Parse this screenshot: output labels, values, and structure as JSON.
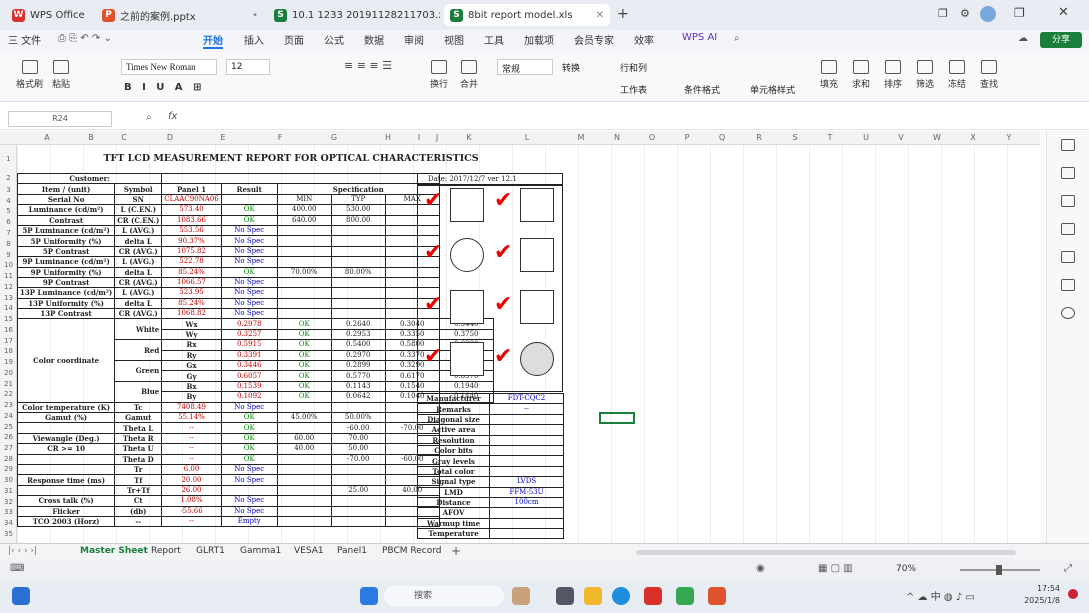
{
  "tabs": [
    {
      "label": "WPS Office",
      "color": "#d9302c",
      "letter": "W"
    },
    {
      "label": "之前的案例.pptx",
      "color": "#e0522b",
      "letter": "P"
    },
    {
      "label": "10.1 1233 20191128211703.xls",
      "color": "#1a7f3c",
      "letter": "S"
    },
    {
      "label": "8bit report model.xls",
      "color": "#1a7f3c",
      "letter": "S"
    }
  ],
  "menu": {
    "file": "三 文件",
    "items": [
      "开始",
      "插入",
      "页面",
      "公式",
      "数据",
      "审阅",
      "视图",
      "工具",
      "加载项",
      "会员专家",
      "效率"
    ],
    "ai": "WPS AI",
    "share": "分享"
  },
  "ribbon": {
    "font": "Times New Roman",
    "size": "12",
    "cellstyle": "常规",
    "labels": [
      "格式刷",
      "粘贴",
      "",
      "",
      "换行",
      "合并",
      "",
      "",
      "",
      "",
      "",
      "转换",
      "行和列",
      "工作表",
      "条件格式",
      "单元格样式",
      "填充",
      "求和",
      "排序",
      "筛选",
      "冻结",
      "查找"
    ]
  },
  "formula": {
    "cellref": "R24",
    "fx": "fx"
  },
  "columns": [
    "A",
    "B",
    "C",
    "D",
    "E",
    "F",
    "G",
    "H",
    "I",
    "J",
    "K",
    "L",
    "M",
    "N",
    "O",
    "P",
    "Q",
    "R",
    "S",
    "T",
    "U",
    "V",
    "W",
    "X",
    "Y"
  ],
  "rows": [
    "1",
    "2",
    "3",
    "4",
    "5",
    "6",
    "7",
    "8",
    "9",
    "10",
    "11",
    "12",
    "13",
    "14",
    "15",
    "16",
    "17",
    "18",
    "19",
    "20",
    "21",
    "22",
    "23",
    "24",
    "25",
    "26",
    "27",
    "28",
    "29",
    "30",
    "31",
    "32",
    "33",
    "34",
    "35"
  ],
  "report": {
    "title": "TFT LCD MEASUREMENT REPORT FOR OPTICAL CHARACTERISTICS",
    "customer": "Customer:",
    "date": "Date:  2017/12/7  ver  12.1",
    "header": [
      "Item / (unit)",
      "Symbol",
      "Panel 1",
      "Result",
      "Specification"
    ],
    "spec": [
      "MIN",
      "TYP",
      "MAX"
    ],
    "rows": [
      [
        "Serial No",
        "SN",
        "CLAAC90NA06",
        "",
        "",
        "",
        ""
      ],
      [
        "Luminance (cd/m²)",
        "L (C.EN.)",
        "573.40",
        "OK",
        "400.00",
        "530.00",
        ""
      ],
      [
        "Contrast",
        "CR (C.EN.)",
        "1083.66",
        "OK",
        "640.00",
        "800.00",
        ""
      ],
      [
        "5P Luminance (cd/m²)",
        "L (AVG.)",
        "553.56",
        "No Spec",
        "",
        "",
        ""
      ],
      [
        "5P Uniformity (%)",
        "delta L",
        "90.37%",
        "No Spec",
        "",
        "",
        ""
      ],
      [
        "5P Contrast",
        "CR (AVG.)",
        "1075.82",
        "No Spec",
        "",
        "",
        ""
      ],
      [
        "9P Luminance (cd/m²)",
        "L (AVG.)",
        "522.78",
        "No Spec",
        "",
        "",
        ""
      ],
      [
        "9P Uniformity (%)",
        "delta L",
        "85.24%",
        "OK",
        "70.00%",
        "80.00%",
        ""
      ],
      [
        "9P Contrast",
        "CR (AVG.)",
        "1066.57",
        "No Spec",
        "",
        "",
        ""
      ],
      [
        "13P Luminance (cd/m²)",
        "L (AVG.)",
        "523.95",
        "No Spec",
        "",
        "",
        ""
      ],
      [
        "13P Uniformity (%)",
        "delta L",
        "85.24%",
        "No Spec",
        "",
        "",
        ""
      ],
      [
        "13P Contrast",
        "CR (AVG.)",
        "1068.82",
        "No Spec",
        "",
        "",
        ""
      ],
      [
        "White",
        "Wx",
        "0.2978",
        "OK",
        "0.2640",
        "0.3040",
        "0.3440"
      ],
      [
        "",
        "Wy",
        "0.3257",
        "OK",
        "0.2953",
        "0.3350",
        "0.3750"
      ],
      [
        "Red",
        "Rx",
        "0.5915",
        "OK",
        "0.5400",
        "0.5800",
        "0.6200"
      ],
      [
        "",
        "Ry",
        "0.3391",
        "OK",
        "0.2970",
        "0.3370",
        "0.3770"
      ],
      [
        "Green",
        "Gx",
        "0.3446",
        "OK",
        "0.2899",
        "0.3290",
        "0.3690"
      ],
      [
        "",
        "Gy",
        "0.6057",
        "OK",
        "0.5770",
        "0.6170",
        "0.6570"
      ],
      [
        "Blue",
        "Bx",
        "0.1539",
        "OK",
        "0.1143",
        "0.1540",
        "0.1940"
      ],
      [
        "",
        "By",
        "0.1092",
        "OK",
        "0.0642",
        "0.1040",
        "0.1440"
      ],
      [
        "Color temperature (K)",
        "Tc",
        "7408.49",
        "No Spec",
        "",
        "",
        ""
      ],
      [
        "Gamut (%)",
        "Gamut",
        "55.14%",
        "OK",
        "45.00%",
        "50.00%",
        ""
      ],
      [
        "",
        "Theta L",
        "--",
        "OK",
        "",
        "-60.00",
        "-70.00"
      ],
      [
        "Viewangle (Deg.)",
        "Theta R",
        "--",
        "OK",
        "60.00",
        "70.00",
        ""
      ],
      [
        "CR >= 10",
        "Theta U",
        "--",
        "OK",
        "40.00",
        "50.00",
        ""
      ],
      [
        "",
        "Theta D",
        "--",
        "OK",
        "",
        "-70.00",
        "-60.00"
      ],
      [
        "",
        "Tr",
        "6.00",
        "No Spec",
        "",
        "",
        ""
      ],
      [
        "Response time (ms)",
        "Tf",
        "20.00",
        "No Spec",
        "",
        "",
        ""
      ],
      [
        "",
        "Tr+Tf",
        "26.00",
        "",
        "",
        "25.00",
        "40.00"
      ],
      [
        "Cross talk (%)",
        "Ct",
        "1.08%",
        "No Spec",
        "",
        "",
        ""
      ],
      [
        "Flicker",
        "(db)",
        "-55.66",
        "No Spec",
        "",
        "",
        ""
      ],
      [
        "TCO 2003 (Horz)",
        "--",
        "--",
        "Empty",
        "",
        "",
        ""
      ]
    ],
    "colorcoord": "Color coordinate",
    "right": [
      [
        "Manufacturer",
        "FDT-CQC2"
      ],
      [
        "Remarks",
        "--"
      ],
      [
        "Diagonal size",
        ""
      ],
      [
        "Active area",
        ""
      ],
      [
        "Resolution",
        ""
      ],
      [
        "Color bits",
        ""
      ],
      [
        "Gray levels",
        ""
      ],
      [
        "Total color",
        ""
      ],
      [
        "Signal type",
        "LVDS"
      ],
      [
        "LMD",
        "FFM-53U"
      ],
      [
        "Distance",
        "100cm"
      ],
      [
        "AFOV",
        ""
      ],
      [
        "Warmup time",
        ""
      ],
      [
        "Temperature",
        ""
      ]
    ]
  },
  "sheets": [
    "Master Sheet",
    "Report",
    "GLRT1",
    "Gamma1",
    "VESA1",
    "Panel1",
    "PBCM Record"
  ],
  "status": {
    "zoom": "70%"
  },
  "taskbar": {
    "search": "搜索",
    "time": "17:54",
    "date": "2025/1/8"
  }
}
